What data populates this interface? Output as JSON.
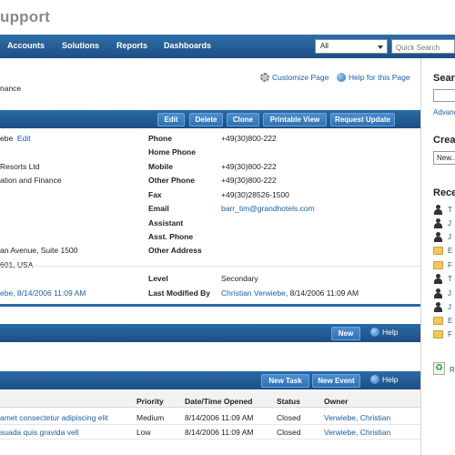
{
  "app": {
    "title": "upport"
  },
  "nav": {
    "items": [
      "Accounts",
      "Solutions",
      "Reports",
      "Dashboards"
    ],
    "select_value": "All",
    "search_placeholder": "Quick Search"
  },
  "header": {
    "subtitle": "nance",
    "customize_link": "Customize Page",
    "help_link": "Help for this Page"
  },
  "detail": {
    "buttons": [
      "Edit",
      "Delete",
      "Clone",
      "Printable View",
      "Request Update"
    ],
    "left": {
      "owner": "ebe",
      "owner_action": "Edit",
      "account": "Resorts Ltd",
      "title": "ation and Finance",
      "address_line1": "an Avenue, Suite 1500",
      "address_line2": "601, USA",
      "created_by": "ebe, 8/14/2006 11:09 AM"
    },
    "labels": {
      "phone": "Phone",
      "home_phone": "Home Phone",
      "mobile": "Mobile",
      "other_phone": "Other Phone",
      "fax": "Fax",
      "email": "Email",
      "assistant": "Assistant",
      "asst_phone": "Asst. Phone",
      "other_address": "Other Address",
      "level": "Level",
      "last_modified": "Last Modified By"
    },
    "values": {
      "phone": "+49(30)800-222",
      "mobile": "+49(30)800-222",
      "other_phone": "+49(30)800-222",
      "fax": "+49(30)28526-1500",
      "email": "barr_tim@grandhotels.com",
      "level": "Secondary",
      "last_modified_name": "Christian Verwiebe",
      "last_modified_date": ", 8/14/2006 11:09 AM"
    }
  },
  "related": {
    "new_button": "New",
    "help": "Help"
  },
  "activities": {
    "buttons": [
      "New Task",
      "New Event"
    ],
    "help": "Help",
    "columns": [
      "Priority",
      "Date/Time Opened",
      "Status",
      "Owner"
    ],
    "rows": [
      {
        "subject": "amet consectetur adipiscing elit",
        "priority": "Medium",
        "opened": "8/14/2006 11:09 AM",
        "status": "Closed",
        "owner": "Verwiebe, Christian"
      },
      {
        "subject": "suada quis gravida vell",
        "priority": "Low",
        "opened": "8/14/2006 11:09 AM",
        "status": "Closed",
        "owner": "Verwiebe, Christian"
      }
    ]
  },
  "sidebar": {
    "search_heading": "Searc",
    "advanced_link": "Advanc",
    "create_heading": "Creat",
    "create_select": "New...",
    "recent_heading": "Rece",
    "recent_items": [
      {
        "icon": "person-icon",
        "label": "T"
      },
      {
        "icon": "person-icon",
        "label": "J"
      },
      {
        "icon": "person-icon",
        "label": "J"
      },
      {
        "icon": "folder-icon",
        "label": "E"
      },
      {
        "icon": "folder-icon",
        "label": "F"
      },
      {
        "icon": "person-icon",
        "label": "T"
      },
      {
        "icon": "person-icon",
        "label": "J"
      },
      {
        "icon": "person-icon",
        "label": "J"
      },
      {
        "icon": "folder-icon",
        "label": "E"
      },
      {
        "icon": "folder-icon",
        "label": "F"
      }
    ],
    "recycle_label": "R"
  }
}
